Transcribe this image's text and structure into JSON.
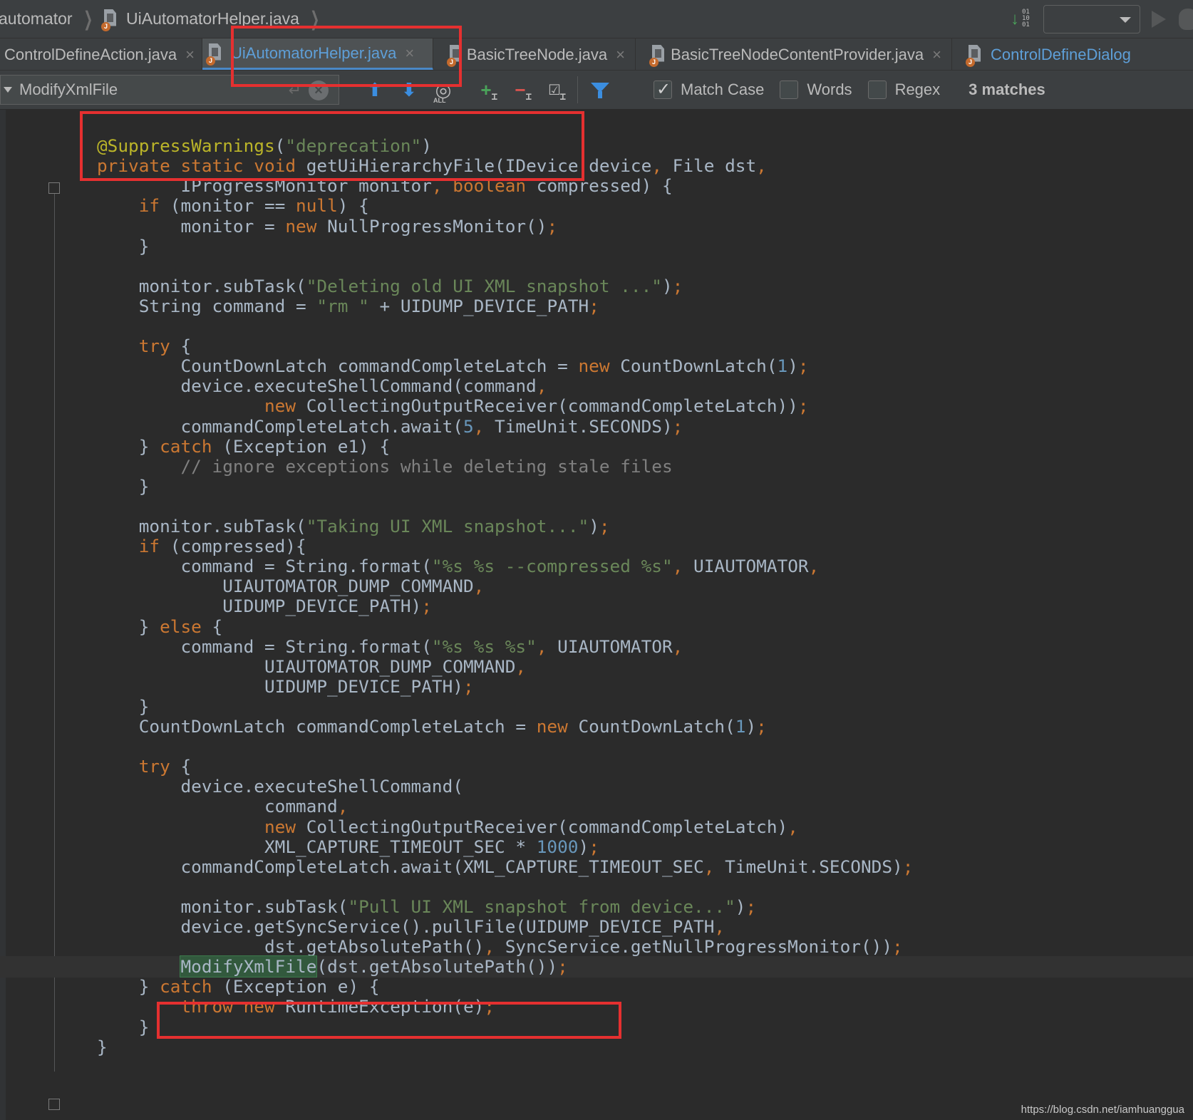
{
  "navbar": {
    "crumbs": [
      "automator",
      "UiAutomatorHelper.java"
    ]
  },
  "tabs": [
    {
      "label": "ControlDefineAction.java",
      "active": false
    },
    {
      "label": "UiAutomatorHelper.java",
      "active": true
    },
    {
      "label": "BasicTreeNode.java",
      "active": false
    },
    {
      "label": "BasicTreeNodeContentProvider.java",
      "active": false
    },
    {
      "label": "ControlDefineDialog",
      "active": false
    }
  ],
  "find": {
    "query": "ModifyXmlFile",
    "match_case_label": "Match Case",
    "match_case_checked": true,
    "words_label": "Words",
    "words_checked": false,
    "regex_label": "Regex",
    "regex_checked": false,
    "matches_text": "3 matches",
    "all_label": "ALL"
  },
  "code_lines": [
    "",
    "@SuppressWarnings(\"deprecation\")",
    "private static void getUiHierarchyFile(IDevice device, File dst,",
    "        IProgressMonitor monitor, boolean compressed) {",
    "    if (monitor == null) {",
    "        monitor = new NullProgressMonitor();",
    "    }",
    "",
    "    monitor.subTask(\"Deleting old UI XML snapshot ...\");",
    "    String command = \"rm \" + UIDUMP_DEVICE_PATH;",
    "",
    "    try {",
    "        CountDownLatch commandCompleteLatch = new CountDownLatch(1);",
    "        device.executeShellCommand(command,",
    "                new CollectingOutputReceiver(commandCompleteLatch));",
    "        commandCompleteLatch.await(5, TimeUnit.SECONDS);",
    "    } catch (Exception e1) {",
    "        // ignore exceptions while deleting stale files",
    "    }",
    "",
    "    monitor.subTask(\"Taking UI XML snapshot...\");",
    "    if (compressed){",
    "        command = String.format(\"%s %s --compressed %s\", UIAUTOMATOR,",
    "            UIAUTOMATOR_DUMP_COMMAND,",
    "            UIDUMP_DEVICE_PATH);",
    "    } else {",
    "        command = String.format(\"%s %s %s\", UIAUTOMATOR,",
    "                UIAUTOMATOR_DUMP_COMMAND,",
    "                UIDUMP_DEVICE_PATH);",
    "    }",
    "    CountDownLatch commandCompleteLatch = new CountDownLatch(1);",
    "",
    "    try {",
    "        device.executeShellCommand(",
    "                command,",
    "                new CollectingOutputReceiver(commandCompleteLatch),",
    "                XML_CAPTURE_TIMEOUT_SEC * 1000);",
    "        commandCompleteLatch.await(XML_CAPTURE_TIMEOUT_SEC, TimeUnit.SECONDS);",
    "",
    "        monitor.subTask(\"Pull UI XML snapshot from device...\");",
    "        device.getSyncService().pullFile(UIDUMP_DEVICE_PATH,",
    "                dst.getAbsolutePath(), SyncService.getNullProgressMonitor());",
    "        ModifyXmlFile(dst.getAbsolutePath());",
    "    } catch (Exception e) {",
    "        throw new RuntimeException(e);",
    "    }",
    "}"
  ],
  "current_line_index": 42,
  "watermark": "https://blog.csdn.net/iamhuanggua",
  "colors": {
    "keyword": "#cc7832",
    "annotation": "#bbb529",
    "string": "#6a8759",
    "number": "#6897bb",
    "comment": "#808080",
    "text": "#a9b7c6",
    "highlight": "#e53030"
  }
}
